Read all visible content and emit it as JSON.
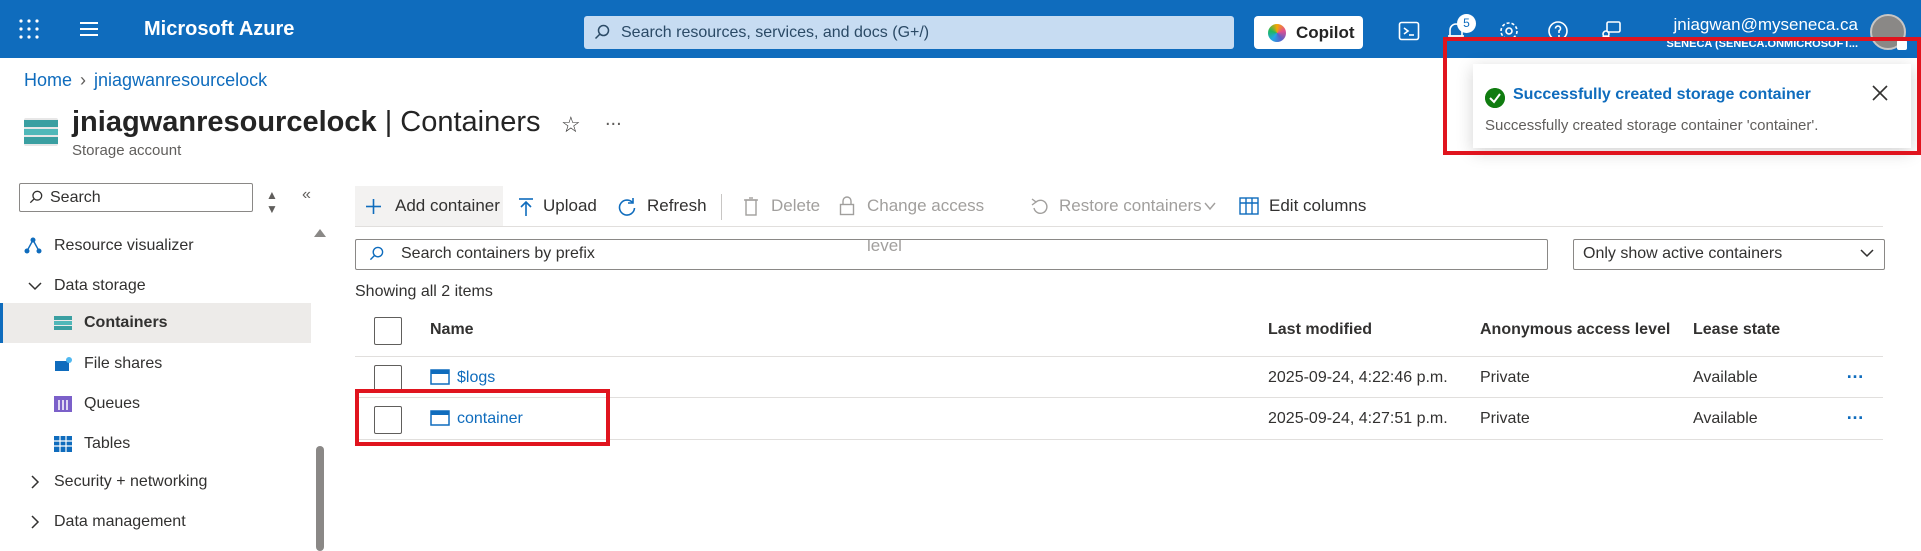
{
  "topbar": {
    "brand": "Microsoft Azure",
    "search_placeholder": "Search resources, services, and docs (G+/)",
    "copilot_label": "Copilot",
    "notification_count": "5",
    "user_email": "jniagwan@myseneca.ca",
    "tenant": "SENECA (SENECA.ONMICROSOFT..."
  },
  "breadcrumb": {
    "home": "Home",
    "resource": "jniagwanresourcelock"
  },
  "header": {
    "resource_name": "jniagwanresourcelock",
    "page_name": "| Containers",
    "subtitle": "Storage account",
    "more": "..."
  },
  "sidebar": {
    "search_placeholder": "Search",
    "items": [
      {
        "label": "Resource visualizer",
        "icon": "resource-visualizer-icon"
      },
      {
        "label": "Data storage",
        "icon": "chevron-down-icon"
      },
      {
        "label": "Containers",
        "icon": "containers-icon"
      },
      {
        "label": "File shares",
        "icon": "file-shares-icon"
      },
      {
        "label": "Queues",
        "icon": "queues-icon"
      },
      {
        "label": "Tables",
        "icon": "tables-icon"
      },
      {
        "label": "Security + networking",
        "icon": "chevron-right-icon"
      },
      {
        "label": "Data management",
        "icon": "chevron-right-icon"
      }
    ]
  },
  "toolbar": {
    "add_container": "Add container",
    "upload": "Upload",
    "refresh": "Refresh",
    "delete": "Delete",
    "change_access": "Change access level",
    "restore": "Restore containers",
    "edit_columns": "Edit columns"
  },
  "filters": {
    "prefix_placeholder": "Search containers by prefix",
    "active_filter": "Only show active containers"
  },
  "showing": "Showing all 2 items",
  "table": {
    "headers": [
      "Name",
      "Last modified",
      "Anonymous access level",
      "Lease state"
    ],
    "rows": [
      {
        "name": "$logs",
        "modified": "2025-09-24, 4:22:46 p.m.",
        "access": "Private",
        "lease": "Available",
        "more": "…"
      },
      {
        "name": "container",
        "modified": "2025-09-24, 4:27:51 p.m.",
        "access": "Private",
        "lease": "Available",
        "more": "…"
      }
    ]
  },
  "toast": {
    "title": "Successfully created storage container",
    "message": "Successfully created storage container 'container'."
  },
  "colors": {
    "azure_blue": "#0f6cbd",
    "highlight_red": "#e0141e",
    "success_green": "#107c10"
  }
}
